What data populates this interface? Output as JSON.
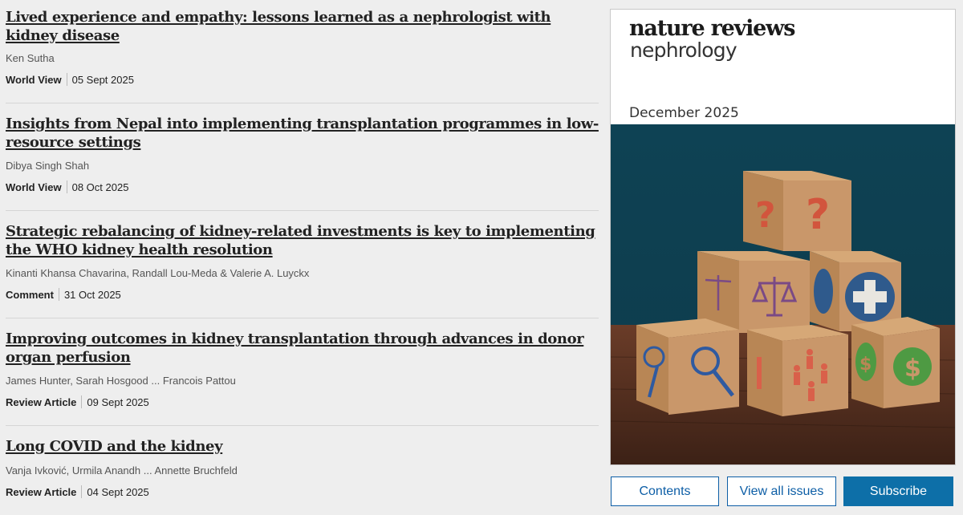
{
  "articles": [
    {
      "title": "Lived experience and empathy: lessons learned as a nephrologist with kidney disease",
      "authors": "Ken Sutha",
      "type": "World View",
      "date": "05 Sept 2025"
    },
    {
      "title": "Insights from Nepal into implementing transplantation programmes in low-resource settings",
      "authors": "Dibya Singh Shah",
      "type": "World View",
      "date": "08 Oct 2025"
    },
    {
      "title": "Strategic rebalancing of kidney-related investments is key to implementing the WHO kidney health resolution",
      "authors": "Kinanti Khansa Chavarina, Randall Lou-Meda & Valerie A. Luyckx",
      "type": "Comment",
      "date": "31 Oct 2025"
    },
    {
      "title": "Improving outcomes in kidney transplantation through advances in donor organ perfusion",
      "authors": "James Hunter, Sarah Hosgood ... Francois Pattou",
      "type": "Review Article",
      "date": "09 Sept 2025"
    },
    {
      "title": "Long COVID and the kidney",
      "authors": "Vanja Ivković, Urmila Anandh ... Annette Bruchfeld",
      "type": "Review Article",
      "date": "04 Sept 2025"
    }
  ],
  "cover": {
    "journal_line1": "nature reviews",
    "journal_line2": "nephrology",
    "issue": "December 2025",
    "image_icon": "cover-illustration-wooden-blocks"
  },
  "buttons": {
    "contents": "Contents",
    "view_all": "View all issues",
    "subscribe": "Subscribe"
  },
  "colors": {
    "accent": "#0d6fa8",
    "background": "#eeeeee"
  }
}
